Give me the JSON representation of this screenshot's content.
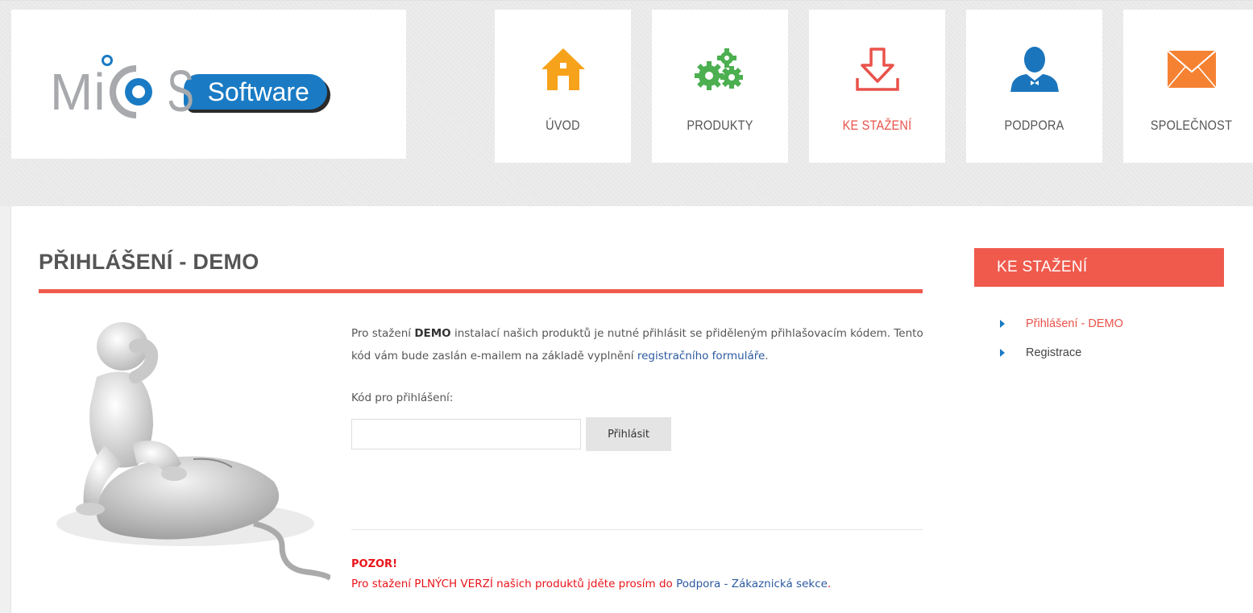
{
  "brand": {
    "logo_text_mi": "Mi",
    "logo_text_s": "S",
    "logo_pill": "Software",
    "colors": {
      "blue": "#1a7bc4",
      "gray": "#a7a9ac",
      "accent": "#ef5a4c",
      "warning": "#e8141a",
      "link": "#2c5aa0"
    }
  },
  "nav": {
    "items": [
      {
        "label": "ÚVOD",
        "icon": "home-icon"
      },
      {
        "label": "PRODUKTY",
        "icon": "gears-icon"
      },
      {
        "label": "KE STAŽENÍ",
        "icon": "download-icon",
        "active": true
      },
      {
        "label": "PODPORA",
        "icon": "support-person-icon"
      },
      {
        "label": "SPOLEČNOST",
        "icon": "envelope-icon"
      }
    ]
  },
  "main": {
    "title": "PŘIHLÁŠENÍ - DEMO",
    "intro_part1": "Pro stažení ",
    "intro_bold": "DEMO",
    "intro_part2": " instalací našich produktů je nutné přihlásit se přiděleným přihlašovacím kódem. Tento kód vám bude zaslán e-mailem na základě vyplnění ",
    "intro_link": "registračního formuláře",
    "intro_end": ".",
    "code_label": "Kód pro přihlášení:",
    "code_value": "",
    "code_placeholder": "",
    "login_button": "Přihlásit",
    "warning_title": "POZOR!",
    "warning_text": "Pro stažení PLNÝCH VERZÍ našich produktů jděte prosím do ",
    "warning_link": "Podpora - Zákaznická sekce",
    "warning_end": "."
  },
  "sidebar": {
    "heading": "KE STAŽENÍ",
    "items": [
      {
        "label": "Přihlášení - DEMO",
        "active": true
      },
      {
        "label": "Registrace",
        "active": false
      }
    ]
  }
}
